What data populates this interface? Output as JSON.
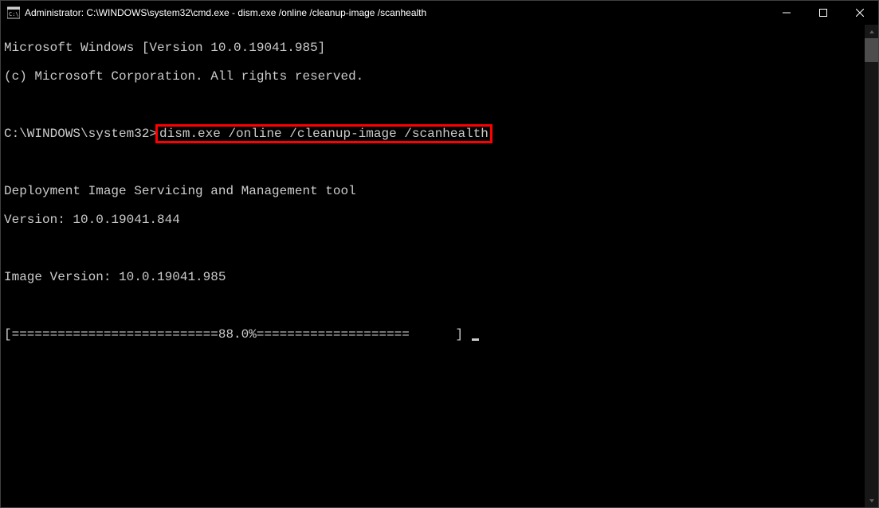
{
  "window": {
    "title": "Administrator: C:\\WINDOWS\\system32\\cmd.exe - dism.exe  /online /cleanup-image /scanhealth"
  },
  "terminal": {
    "line1": "Microsoft Windows [Version 10.0.19041.985]",
    "line2": "(c) Microsoft Corporation. All rights reserved.",
    "blank1": "",
    "prompt": "C:\\WINDOWS\\system32>",
    "command": "dism.exe /online /cleanup-image /scanhealth",
    "blank2": "",
    "tool_line": "Deployment Image Servicing and Management tool",
    "version_line": "Version: 10.0.19041.844",
    "blank3": "",
    "image_version": "Image Version: 10.0.19041.985",
    "blank4": "",
    "progress": "[===========================88.0%====================      ] "
  }
}
